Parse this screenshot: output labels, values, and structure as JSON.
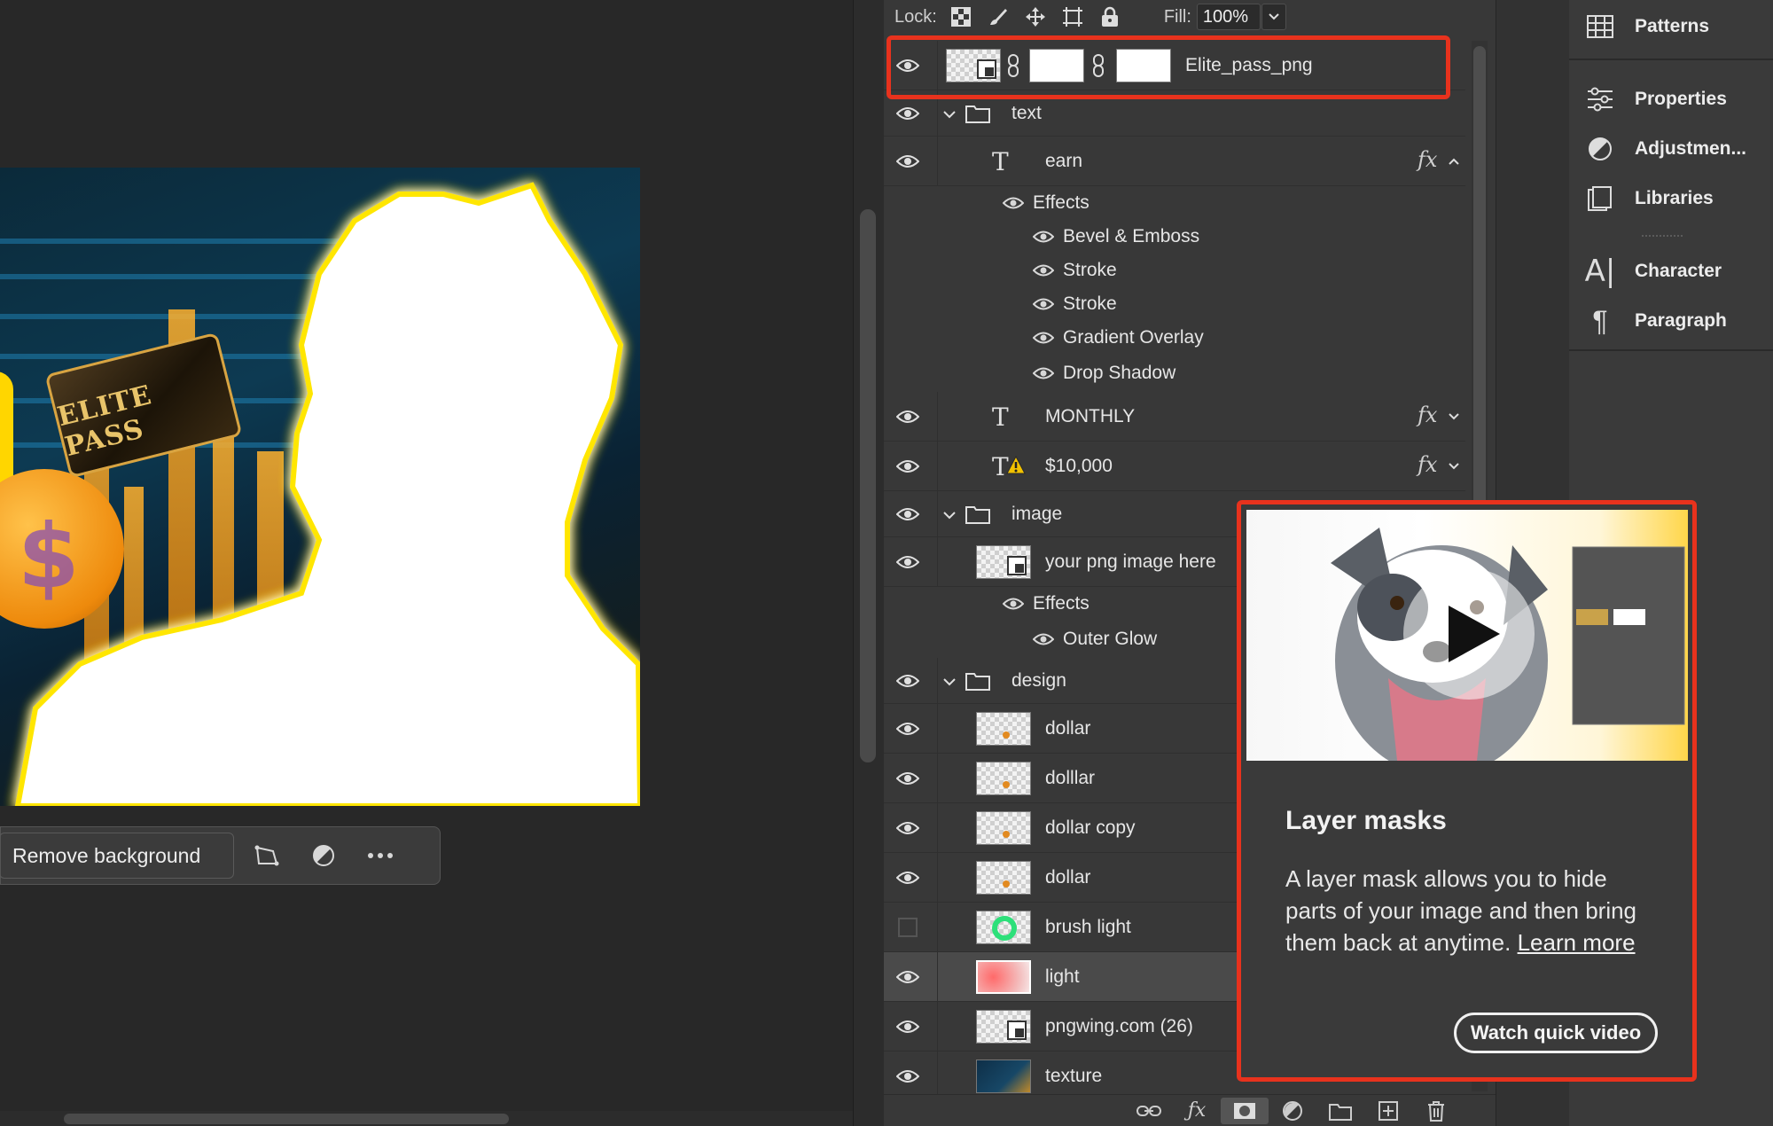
{
  "canvas": {
    "card_text": "ELITE PASS",
    "context_toolbar": {
      "remove_background_label": "Remove background"
    }
  },
  "lock_bar": {
    "lock_label": "Lock:",
    "fill_label": "Fill:",
    "fill_value": "100%"
  },
  "layers": [
    {
      "name": "Elite_pass_png",
      "kind": "smart-linked-masks"
    },
    {
      "name": "text",
      "kind": "group"
    },
    {
      "name": "earn",
      "kind": "type",
      "fx": "fx"
    },
    {
      "name": "Effects",
      "kind": "effects-header"
    },
    {
      "name": "Bevel & Emboss",
      "kind": "effect"
    },
    {
      "name": "Stroke",
      "kind": "effect"
    },
    {
      "name": "Stroke",
      "kind": "effect"
    },
    {
      "name": "Gradient Overlay",
      "kind": "effect"
    },
    {
      "name": "Drop Shadow",
      "kind": "effect"
    },
    {
      "name": "MONTHLY",
      "kind": "type",
      "fx": "fx"
    },
    {
      "name": "$10,000",
      "kind": "type-warn",
      "fx": "fx"
    },
    {
      "name": "image",
      "kind": "group"
    },
    {
      "name": "your png image here",
      "kind": "smart"
    },
    {
      "name": "Effects",
      "kind": "effects-header"
    },
    {
      "name": "Outer Glow",
      "kind": "effect"
    },
    {
      "name": "design",
      "kind": "group"
    },
    {
      "name": "dollar",
      "kind": "pixel"
    },
    {
      "name": "dolllar",
      "kind": "pixel"
    },
    {
      "name": "dollar copy",
      "kind": "pixel"
    },
    {
      "name": "dollar",
      "kind": "pixel"
    },
    {
      "name": "brush light",
      "kind": "pixel-hidden"
    },
    {
      "name": "light",
      "kind": "pixel-selected"
    },
    {
      "name": "pngwing.com (26)",
      "kind": "smart"
    },
    {
      "name": "texture",
      "kind": "pixel-texture"
    }
  ],
  "dock": {
    "items": [
      "Patterns",
      "Properties",
      "Adjustmen...",
      "Libraries",
      "Character",
      "Paragraph"
    ]
  },
  "tooltip": {
    "title": "Layer masks",
    "body": "A layer mask allows you to hide parts of your image and then bring them back at anytime.",
    "link": "Learn more",
    "button": "Watch quick video"
  },
  "colors": {
    "highlight": "#e8321d",
    "panel": "#383838",
    "canvas_bg": "#282828"
  }
}
